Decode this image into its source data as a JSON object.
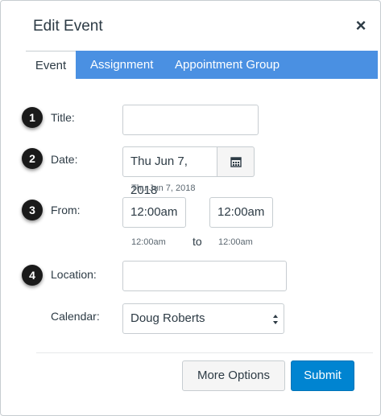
{
  "dialog": {
    "title": "Edit Event",
    "close_glyph": "×"
  },
  "tabs": [
    {
      "label": "Event",
      "active": true
    },
    {
      "label": "Assignment",
      "active": false
    },
    {
      "label": "Appointment Group",
      "active": false
    }
  ],
  "badges": [
    "1",
    "2",
    "3",
    "4"
  ],
  "form": {
    "title_label": "Title:",
    "title_value": "",
    "date_label": "Date:",
    "date_value": "Thu Jun 7, 2018",
    "date_hint": "Thu Jun 7, 2018",
    "calendar_icon": "calendar-icon",
    "from_label": "From:",
    "from_value": "12:00am",
    "from_hint": "12:00am",
    "to_label": "to",
    "to_value": "12:00am",
    "to_hint": "12:00am",
    "location_label": "Location:",
    "location_value": "",
    "calendar_label": "Calendar:",
    "calendar_value": "Doug Roberts"
  },
  "footer": {
    "more_options_label": "More Options",
    "submit_label": "Submit"
  },
  "colors": {
    "tab_bar": "#4a90e2",
    "submit": "#0084d1",
    "badge": "#1a1a1a"
  }
}
